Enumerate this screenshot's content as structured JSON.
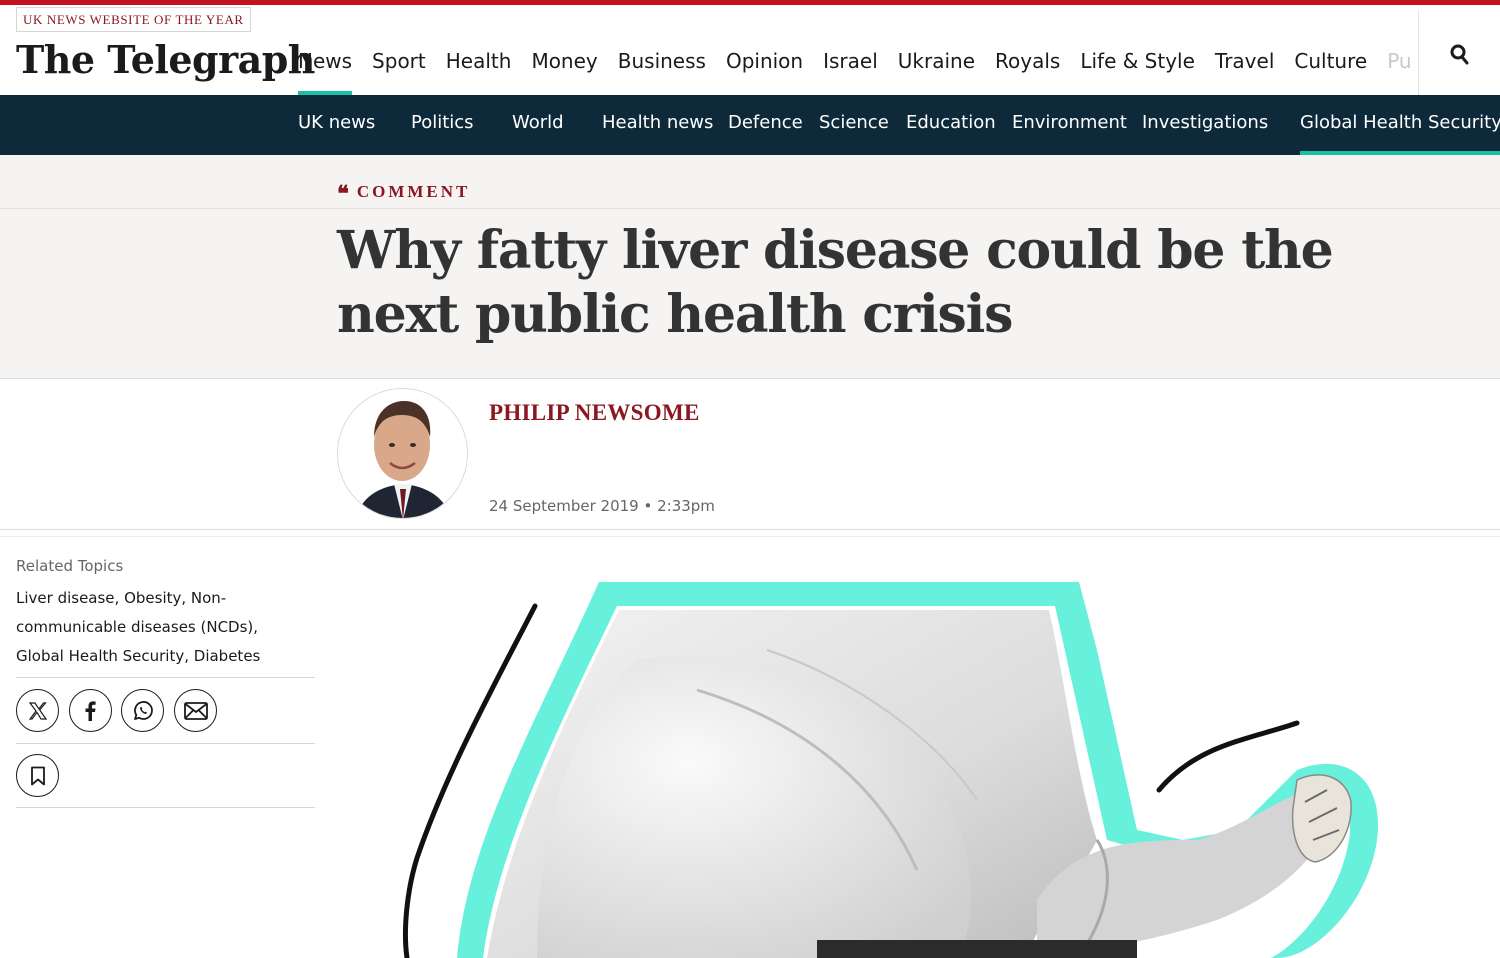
{
  "site": {
    "award": "UK NEWS WEBSITE OF THE YEAR",
    "logo": "The Telegraph",
    "accent_color": "#c3121f",
    "brand_color": "#8a1721",
    "highlight_color": "#1bbfa6",
    "subnav_bg": "#0e2a3a"
  },
  "primary_nav": [
    {
      "label": "News"
    },
    {
      "label": "Sport"
    },
    {
      "label": "Health"
    },
    {
      "label": "Money"
    },
    {
      "label": "Business"
    },
    {
      "label": "Opinion"
    },
    {
      "label": "Israel"
    },
    {
      "label": "Ukraine"
    },
    {
      "label": "Royals"
    },
    {
      "label": "Life & Style"
    },
    {
      "label": "Travel"
    },
    {
      "label": "Culture"
    },
    {
      "label": "Pu"
    }
  ],
  "search": {
    "icon": "search-icon"
  },
  "secondary_nav": [
    {
      "label": "UK news"
    },
    {
      "label": "Politics"
    },
    {
      "label": "World"
    },
    {
      "label": "Health news"
    },
    {
      "label": "Defence"
    },
    {
      "label": "Science"
    },
    {
      "label": "Education"
    },
    {
      "label": "Environment"
    },
    {
      "label": "Investigations"
    },
    {
      "label": "Global Health Security"
    }
  ],
  "article": {
    "kicker_icon": "quote-icon",
    "kicker": "COMMENT",
    "headline": "Why fatty liver disease could be the next public health crisis",
    "author": "PHILIP NEWSOME",
    "dateline": "24 September 2019 • 2:33pm"
  },
  "sidebar": {
    "related_label": "Related Topics",
    "related_topics": "Liver disease, Obesity, Non-communicable diseases (NCDs), Global Health Security, Diabetes",
    "share_icons": [
      "x-icon",
      "facebook-icon",
      "whatsapp-icon",
      "email-icon"
    ],
    "bookmark_icon": "bookmark-icon"
  }
}
